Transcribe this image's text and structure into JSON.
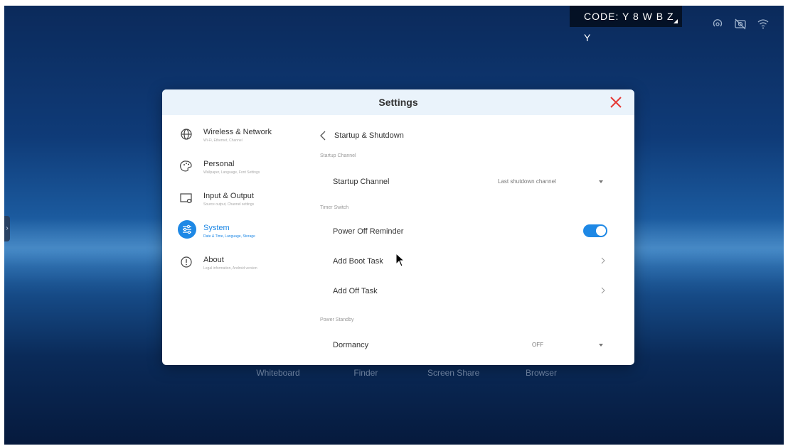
{
  "status_bar": {
    "code_text": "CODE: Y 8 W B Z Y",
    "icons": [
      "hotspot-icon",
      "camera-off-icon",
      "wifi-icon"
    ]
  },
  "dock": {
    "items": [
      "Whiteboard",
      "Finder",
      "Screen Share",
      "Browser"
    ]
  },
  "dialog": {
    "title": "Settings",
    "accent_color": "#1e88e5",
    "close_color": "#e53935"
  },
  "sidebar": {
    "items": [
      {
        "label": "Wireless & Network",
        "sub": "Wi-Fi, Ethernet, Channel",
        "icon": "globe-icon"
      },
      {
        "label": "Personal",
        "sub": "Wallpaper, Language, Font Settings",
        "icon": "palette-icon"
      },
      {
        "label": "Input & Output",
        "sub": "Source output, Channel settings",
        "icon": "input-output-icon"
      },
      {
        "label": "System",
        "sub": "Date & Time, Language, Storage",
        "icon": "sliders-icon",
        "active": true
      },
      {
        "label": "About",
        "sub": "Legal information, Android version",
        "icon": "info-icon"
      }
    ]
  },
  "content": {
    "back_title": "Startup & Shutdown",
    "sections": {
      "startup_channel": "Startup Channel",
      "timer_switch": "Timer Switch",
      "power_standby": "Power Standby"
    },
    "rows": {
      "startup_channel": {
        "label": "Startup Channel",
        "value": "Last shutdown channel"
      },
      "power_off_reminder": {
        "label": "Power Off Reminder",
        "enabled": true
      },
      "add_boot_task": {
        "label": "Add Boot Task"
      },
      "add_off_task": {
        "label": "Add Off Task"
      },
      "dormancy": {
        "label": "Dormancy",
        "value": "OFF"
      }
    }
  }
}
